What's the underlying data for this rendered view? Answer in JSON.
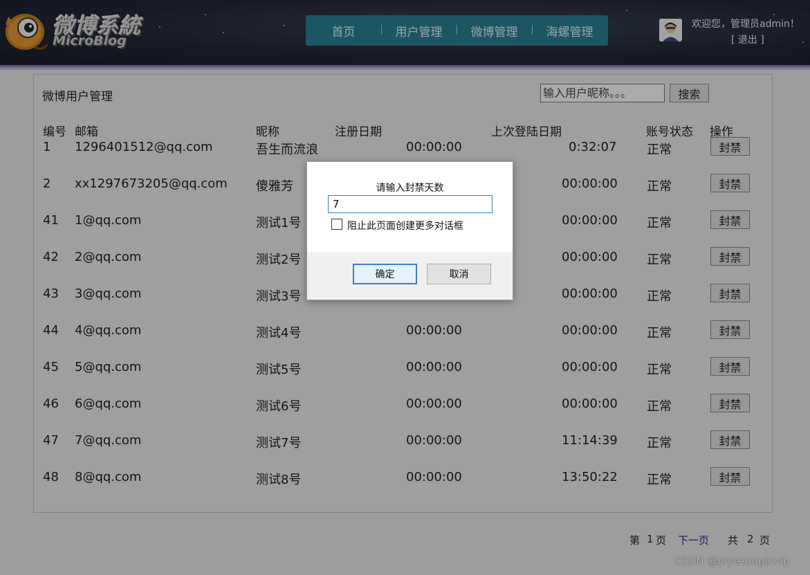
{
  "header": {
    "logo_title": "微博系統",
    "logo_subtitle": "MicroBlog",
    "nav": [
      "首页",
      "用户管理",
      "微博管理",
      "海螺管理"
    ],
    "welcome": "欢迎您，管理员admin！",
    "logout": "[ 退出 ]"
  },
  "page": {
    "title": "微博用户管理",
    "search_placeholder": "输入用户昵称。。。",
    "search_button": "搜索"
  },
  "table": {
    "columns": [
      "编号",
      "邮箱",
      "昵称",
      "注册日期",
      "上次登陆日期",
      "账号状态",
      "操作"
    ],
    "rows": [
      {
        "id": "1",
        "email": "1296401512@qq.com",
        "nickname": "吾生而流浪",
        "reg_time": "00:00:00",
        "last_login_time": "0:32:07",
        "status": "正常",
        "action": "封禁"
      },
      {
        "id": "2",
        "email": "xx1297673205@qq.com",
        "nickname": "傻雅芳",
        "reg_time": "",
        "last_login_time": "00:00:00",
        "status": "正常",
        "action": "封禁"
      },
      {
        "id": "41",
        "email": "1@qq.com",
        "nickname": "测试1号",
        "reg_time": "",
        "last_login_time": "00:00:00",
        "status": "正常",
        "action": "封禁"
      },
      {
        "id": "42",
        "email": "2@qq.com",
        "nickname": "测试2号",
        "reg_time": "",
        "last_login_time": "00:00:00",
        "status": "正常",
        "action": "封禁"
      },
      {
        "id": "43",
        "email": "3@qq.com",
        "nickname": "测试3号",
        "reg_time": "",
        "last_login_time": "00:00:00",
        "status": "正常",
        "action": "封禁"
      },
      {
        "id": "44",
        "email": "4@qq.com",
        "nickname": "测试4号",
        "reg_time": "00:00:00",
        "last_login_time": "00:00:00",
        "status": "正常",
        "action": "封禁"
      },
      {
        "id": "45",
        "email": "5@qq.com",
        "nickname": "测试5号",
        "reg_time": "00:00:00",
        "last_login_time": "00:00:00",
        "status": "正常",
        "action": "封禁"
      },
      {
        "id": "46",
        "email": "6@qq.com",
        "nickname": "测试6号",
        "reg_time": "00:00:00",
        "last_login_time": "00:00:00",
        "status": "正常",
        "action": "封禁"
      },
      {
        "id": "47",
        "email": "7@qq.com",
        "nickname": "测试7号",
        "reg_time": "00:00:00",
        "last_login_time": "11:14:39",
        "status": "正常",
        "action": "封禁"
      },
      {
        "id": "48",
        "email": "8@qq.com",
        "nickname": "测试8号",
        "reg_time": "00:00:00",
        "last_login_time": "13:50:22",
        "status": "正常",
        "action": "封禁"
      }
    ]
  },
  "pager": {
    "current_prefix": "第",
    "current_page": "1",
    "current_suffix": "页",
    "next": "下一页",
    "total_prefix": "共",
    "total_pages": "2",
    "total_suffix": "页"
  },
  "dialog": {
    "message": "请输入封禁天数",
    "input_value": "7",
    "checkbox_label": "阻止此页面创建更多对话框",
    "ok": "确定",
    "cancel": "取消"
  },
  "watermark": "CSDN @biyezuopinvip",
  "colors": {
    "nav_bg": "#2a8196",
    "header_bg": "#232838",
    "page_bg": "#ebebeb",
    "dialog_focus": "#3c7fc6"
  }
}
